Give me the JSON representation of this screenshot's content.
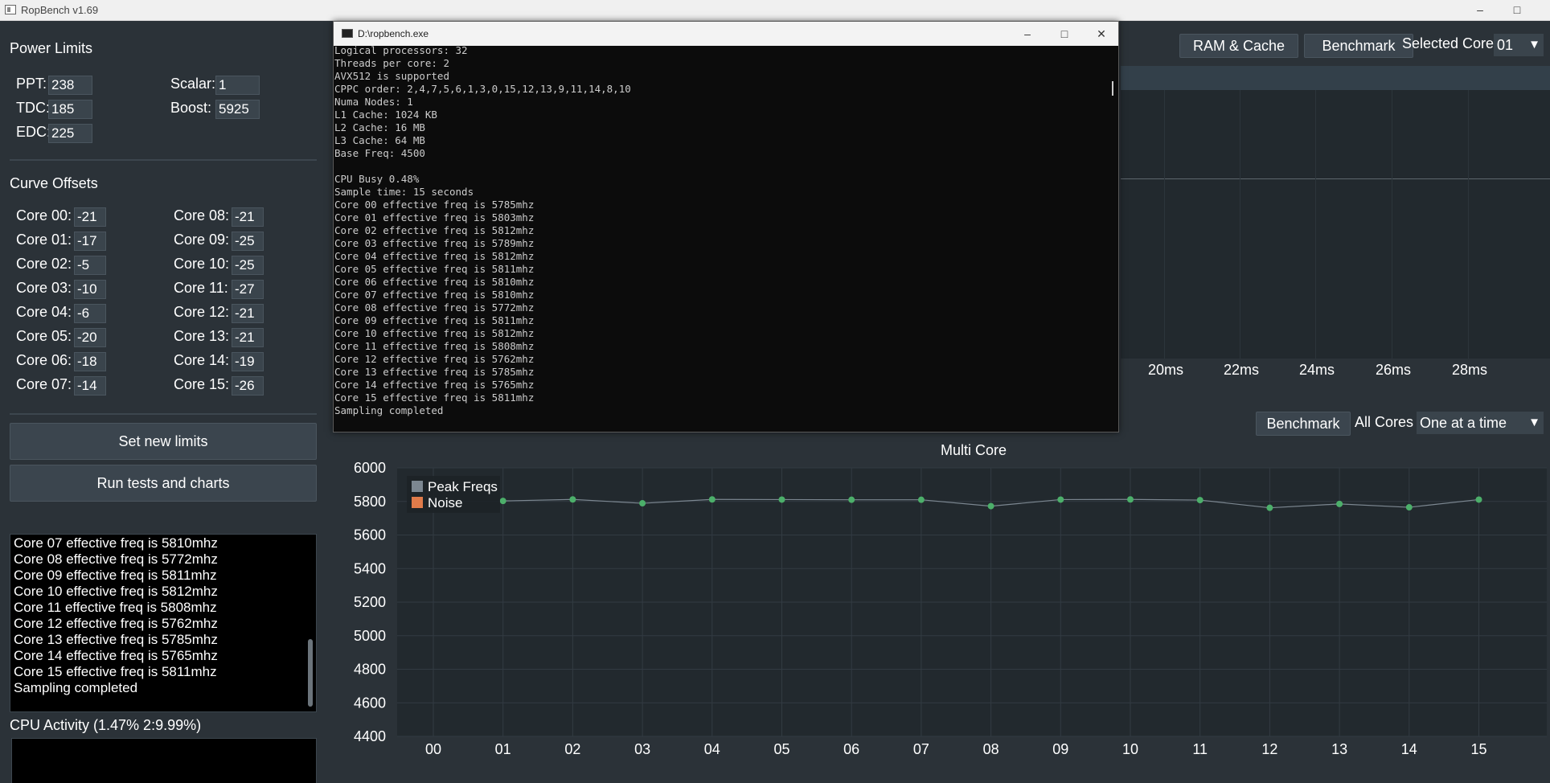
{
  "window": {
    "title": "RopBench v1.69",
    "minimize_glyph": "–",
    "maximize_glyph": "□"
  },
  "power_limits": {
    "title": "Power Limits",
    "ppt_label": "PPT:",
    "ppt_value": "238",
    "tdc_label": "TDC:",
    "tdc_value": "185",
    "edc_label": "EDC:",
    "edc_value": "225",
    "scalar_label": "Scalar:",
    "scalar_value": "1",
    "boost_label": "Boost:",
    "boost_value": "5925"
  },
  "curve_offsets": {
    "title": "Curve Offsets",
    "cores": [
      {
        "label": "Core 00:",
        "value": "-21"
      },
      {
        "label": "Core 01:",
        "value": "-17"
      },
      {
        "label": "Core 02:",
        "value": "-5"
      },
      {
        "label": "Core 03:",
        "value": "-10"
      },
      {
        "label": "Core 04:",
        "value": "-6"
      },
      {
        "label": "Core 05:",
        "value": "-20"
      },
      {
        "label": "Core 06:",
        "value": "-18"
      },
      {
        "label": "Core 07:",
        "value": "-14"
      },
      {
        "label": "Core 08:",
        "value": "-21"
      },
      {
        "label": "Core 09:",
        "value": "-25"
      },
      {
        "label": "Core 10:",
        "value": "-25"
      },
      {
        "label": "Core 11:",
        "value": "-27"
      },
      {
        "label": "Core 12:",
        "value": "-21"
      },
      {
        "label": "Core 13:",
        "value": "-21"
      },
      {
        "label": "Core 14:",
        "value": "-19"
      },
      {
        "label": "Core 15:",
        "value": "-26"
      }
    ]
  },
  "buttons": {
    "set_limits": "Set new limits",
    "run_tests": "Run tests and charts"
  },
  "log": {
    "lines": [
      "Core 07 effective freq is 5810mhz",
      "Core 08 effective freq is 5772mhz",
      "Core 09 effective freq is 5811mhz",
      "Core 10 effective freq is 5812mhz",
      "Core 11 effective freq is 5808mhz",
      "Core 12 effective freq is 5762mhz",
      "Core 13 effective freq is 5785mhz",
      "Core 14 effective freq is 5765mhz",
      "Core 15 effective freq is 5811mhz",
      "Sampling completed"
    ]
  },
  "cpu_activity": {
    "label": "CPU Activity (1.47% 2:9.99%)"
  },
  "top_toolbar": {
    "ram_cache": "RAM & Cache",
    "benchmark": "Benchmark",
    "selected_core_label": "Selected Core",
    "selected_core_value": "01"
  },
  "upper_chart": {
    "x_ticks": [
      "20ms",
      "22ms",
      "24ms",
      "26ms",
      "28ms"
    ]
  },
  "mid_toolbar": {
    "benchmark": "Benchmark",
    "all_cores": "All Cores",
    "mode_value": "One at a time"
  },
  "console": {
    "title": "D:\\ropbench.exe",
    "lines": [
      "Logical processors: 32",
      "Threads per core: 2",
      "AVX512 is supported",
      "CPPC order: 2,4,7,5,6,1,3,0,15,12,13,9,11,14,8,10",
      "Numa Nodes: 1",
      "L1 Cache: 1024 KB",
      "L2 Cache: 16 MB",
      "L3 Cache: 64 MB",
      "Base Freq: 4500",
      "",
      "CPU Busy 0.48%",
      "Sample time: 15 seconds",
      "Core 00 effective freq is 5785mhz",
      "Core 01 effective freq is 5803mhz",
      "Core 02 effective freq is 5812mhz",
      "Core 03 effective freq is 5789mhz",
      "Core 04 effective freq is 5812mhz",
      "Core 05 effective freq is 5811mhz",
      "Core 06 effective freq is 5810mhz",
      "Core 07 effective freq is 5810mhz",
      "Core 08 effective freq is 5772mhz",
      "Core 09 effective freq is 5811mhz",
      "Core 10 effective freq is 5812mhz",
      "Core 11 effective freq is 5808mhz",
      "Core 12 effective freq is 5762mhz",
      "Core 13 effective freq is 5785mhz",
      "Core 14 effective freq is 5765mhz",
      "Core 15 effective freq is 5811mhz",
      "Sampling completed"
    ]
  },
  "chart_data": {
    "type": "line",
    "title": "Multi Core",
    "categories": [
      "00",
      "01",
      "02",
      "03",
      "04",
      "05",
      "06",
      "07",
      "08",
      "09",
      "10",
      "11",
      "12",
      "13",
      "14",
      "15"
    ],
    "series": [
      {
        "name": "Peak Freqs",
        "color": "#7c8791",
        "values": [
          null,
          5803,
          5812,
          5789,
          5812,
          5811,
          5810,
          5810,
          5772,
          5811,
          5812,
          5808,
          5762,
          5785,
          5765,
          5811
        ]
      },
      {
        "name": "Noise",
        "color": "#e07b4a",
        "values": []
      }
    ],
    "point_color": "#4caf6a",
    "ylim": [
      4400,
      6000
    ],
    "yticks": [
      6000,
      5800,
      5600,
      5400,
      5200,
      5000,
      4800,
      4600,
      4400
    ],
    "grid": true,
    "legend_position": "top-left"
  }
}
